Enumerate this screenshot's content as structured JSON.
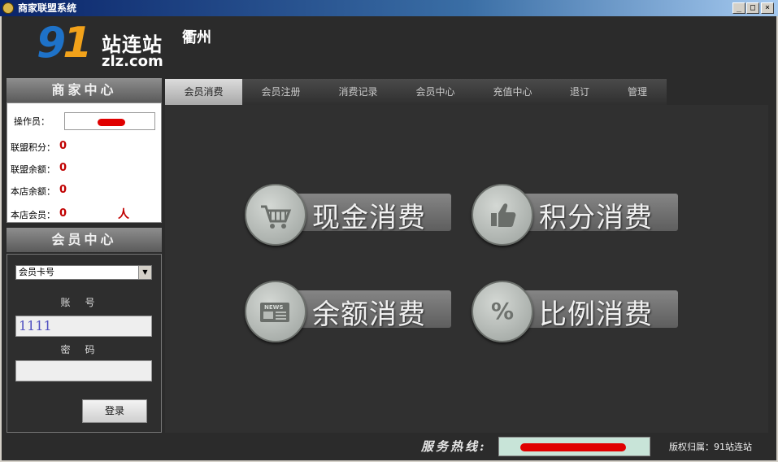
{
  "window": {
    "title": "商家联盟系统",
    "min": "_",
    "max": "□",
    "close": "×"
  },
  "header": {
    "logo_num_9": "9",
    "logo_num_1": "1",
    "logo_cn": "站连站",
    "logo_domain": "zlz.com",
    "city": "衢州"
  },
  "merchant": {
    "title": "商家中心",
    "operator_label": "操作员：",
    "rows": [
      {
        "label": "联盟积分：",
        "value": "0"
      },
      {
        "label": "联盟余额：",
        "value": "0"
      },
      {
        "label": "本店余额：",
        "value": "0"
      },
      {
        "label": "本店会员：",
        "value": "0"
      }
    ],
    "member_unit": "人"
  },
  "member": {
    "title": "会员中心",
    "select_value": "会员卡号",
    "account_label": "账号",
    "account_value": "1111",
    "password_label": "密码",
    "login_label": "登录"
  },
  "tabs": [
    "会员消费",
    "会员注册",
    "消费记录",
    "会员中心",
    "充值中心",
    "退订",
    "管理"
  ],
  "actions": [
    {
      "label": "现金消费",
      "icon": "cart-icon"
    },
    {
      "label": "积分消费",
      "icon": "thumbs-up-icon"
    },
    {
      "label": "余额消费",
      "icon": "news-icon",
      "glyph": "NEWS"
    },
    {
      "label": "比例消费",
      "icon": "percent-icon",
      "glyph": "%"
    }
  ],
  "footer": {
    "hotline_label": "服务热线:",
    "copyright": "版权归属：91站连站"
  },
  "colors": {
    "accent_blue": "#1e72c8",
    "accent_orange": "#f2a21a",
    "value_red": "#c00000"
  }
}
